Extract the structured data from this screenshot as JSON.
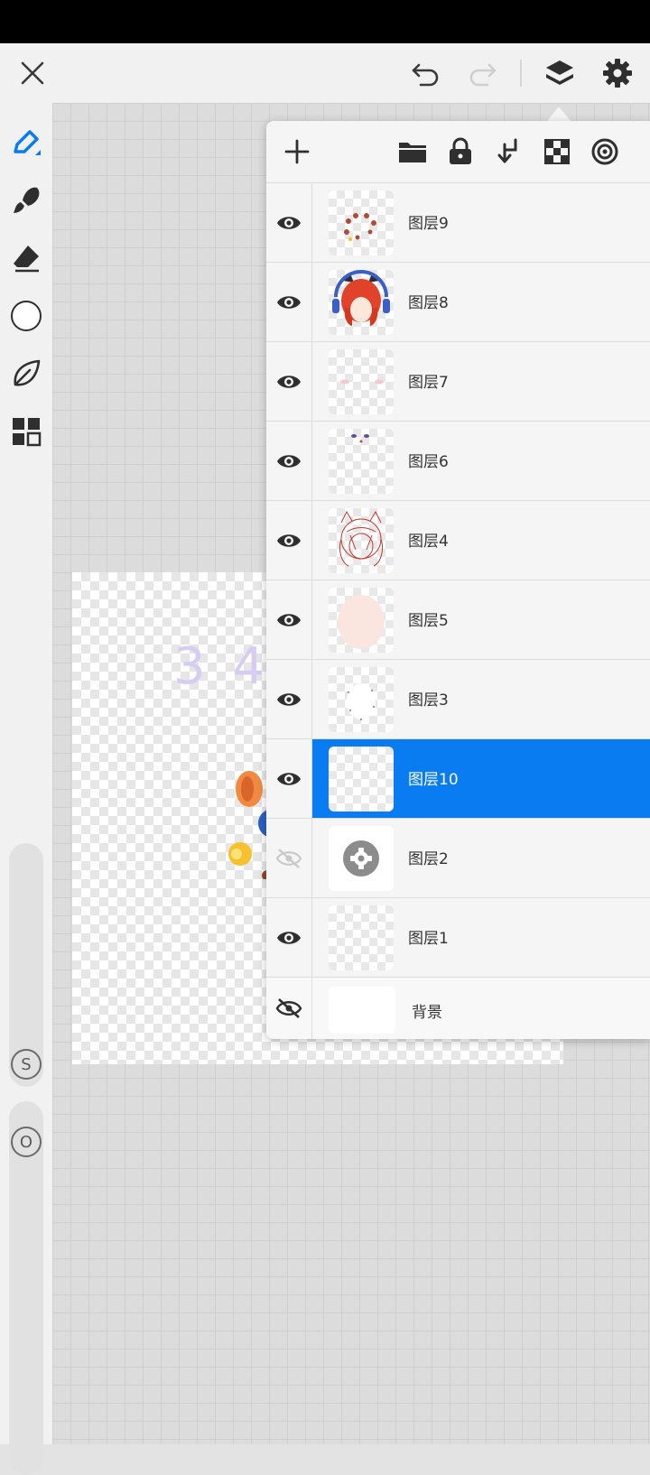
{
  "topbar": {
    "close_icon": "close-icon",
    "undo_icon": "undo-icon",
    "redo_icon": "redo-icon",
    "layers_icon": "layers-icon",
    "settings_icon": "gear-icon"
  },
  "sidebar": {
    "tools": [
      "pen-icon",
      "brush-icon",
      "eraser-icon",
      "color-circle-icon",
      "leaf-icon",
      "grid-icon"
    ],
    "size_label": "S",
    "opacity_label": "O"
  },
  "canvas": {
    "doc_text": "3 4"
  },
  "layers_panel": {
    "toolbar_icons": [
      "plus-icon",
      "folder-icon",
      "lock-icon",
      "merge-down-icon",
      "checker-icon",
      "target-icon"
    ],
    "layers": [
      {
        "name": "图层9",
        "visible": true
      },
      {
        "name": "图层8",
        "visible": true
      },
      {
        "name": "图层7",
        "visible": true
      },
      {
        "name": "图层6",
        "visible": true
      },
      {
        "name": "图层4",
        "visible": true
      },
      {
        "name": "图层5",
        "visible": true
      },
      {
        "name": "图层3",
        "visible": true
      },
      {
        "name": "图层10",
        "visible": true,
        "selected": true
      },
      {
        "name": "图层2",
        "visible": false
      },
      {
        "name": "图层1",
        "visible": true
      }
    ],
    "background": {
      "name": "背景",
      "visible": false
    }
  },
  "colors": {
    "selected": "#0a7cf1",
    "icon": "#3a3a3a"
  }
}
